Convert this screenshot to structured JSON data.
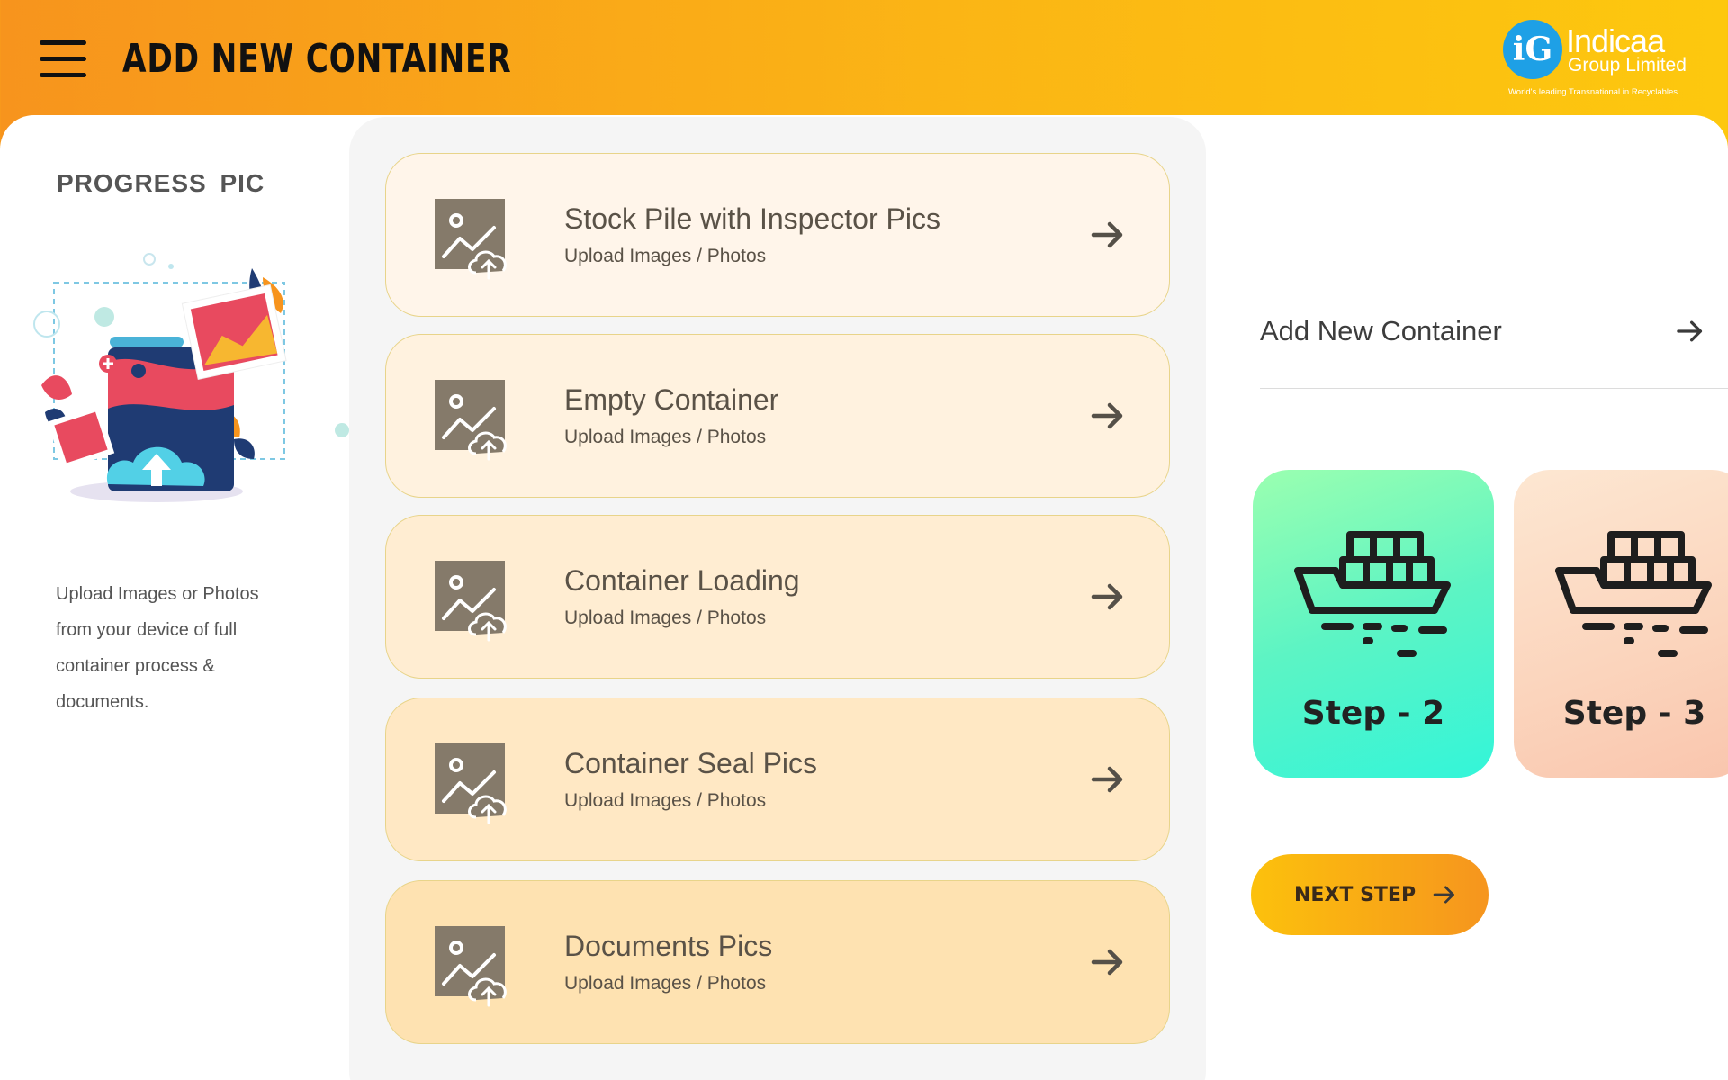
{
  "header": {
    "title": "ADD NEW CONTAINER",
    "logo": {
      "mark": "iG",
      "name": "Indicaa",
      "sub": "Group Limited",
      "tagline": "World's leading Transnational in Recyclables"
    }
  },
  "left_panel": {
    "title": "PROGRESS PIC",
    "description": "Upload Images or Photos\nfrom your device of full\ncontainer  process &\ndocuments.",
    "illustration_icon": "upload-photos-illustration"
  },
  "upload_cards": [
    {
      "title": "Stock Pile with Inspector Pics",
      "subtitle": "Upload Images / Photos",
      "bg": "#fff5ea"
    },
    {
      "title": "Empty Container",
      "subtitle": "Upload Images / Photos",
      "bg": "#fff2df"
    },
    {
      "title": "Container Loading",
      "subtitle": "Upload Images / Photos",
      "bg": "#ffedd2"
    },
    {
      "title": "Container Seal Pics",
      "subtitle": "Upload Images / Photos",
      "bg": "#ffe8c4"
    },
    {
      "title": "Documents Pics",
      "subtitle": "Upload Images / Photos",
      "bg": "#fee2b1"
    }
  ],
  "right_panel": {
    "add_new_label": "Add New Container",
    "steps": [
      {
        "label": "Step - 2",
        "icon": "cargo-ship-icon"
      },
      {
        "label": "Step - 3",
        "icon": "cargo-ship-icon"
      }
    ],
    "next_button": "NEXT STEP"
  },
  "colors": {
    "header_start": "#f7941d",
    "header_end": "#fdc80e",
    "card_border": "#e8d48a",
    "icon_brown": "#857a6a",
    "text_brown": "#5a5247"
  }
}
